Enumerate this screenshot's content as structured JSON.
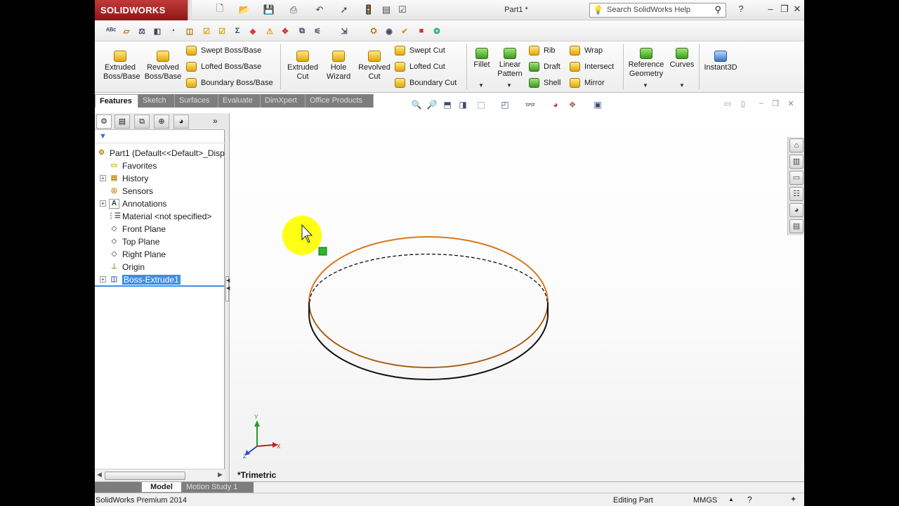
{
  "app": {
    "brand": "SOLIDWORKS",
    "document_title": "Part1 *",
    "search_placeholder": "Search SolidWorks Help"
  },
  "command_manager": {
    "extruded_boss": "Extruded\nBoss/Base",
    "revolved_boss": "Revolved\nBoss/Base",
    "swept_boss": "Swept Boss/Base",
    "lofted_boss": "Lofted Boss/Base",
    "boundary_boss": "Boundary Boss/Base",
    "extruded_cut": "Extruded\nCut",
    "hole_wizard": "Hole\nWizard",
    "revolved_cut": "Revolved\nCut",
    "swept_cut": "Swept Cut",
    "lofted_cut": "Lofted Cut",
    "boundary_cut": "Boundary Cut",
    "fillet": "Fillet",
    "linear_pattern": "Linear\nPattern",
    "rib": "Rib",
    "draft": "Draft",
    "shell": "Shell",
    "wrap": "Wrap",
    "intersect": "Intersect",
    "mirror": "Mirror",
    "reference_geometry": "Reference\nGeometry",
    "curves": "Curves",
    "instant3d": "Instant3D"
  },
  "tabs": [
    "Features",
    "Sketch",
    "Surfaces",
    "Evaluate",
    "DimXpert",
    "Office Products"
  ],
  "feature_tree": {
    "root": "Part1  (Default<<Default>_Disp",
    "items": [
      {
        "label": "Favorites",
        "icon": "folder-icon"
      },
      {
        "label": "History",
        "icon": "history-icon"
      },
      {
        "label": "Sensors",
        "icon": "sensor-icon"
      },
      {
        "label": "Annotations",
        "icon": "annotation-icon"
      },
      {
        "label": "Material <not specified>",
        "icon": "material-icon"
      },
      {
        "label": "Front Plane",
        "icon": "plane-icon"
      },
      {
        "label": "Top Plane",
        "icon": "plane-icon"
      },
      {
        "label": "Right Plane",
        "icon": "plane-icon"
      },
      {
        "label": "Origin",
        "icon": "origin-icon"
      },
      {
        "label": "Boss-Extrude1",
        "icon": "extrude-icon"
      }
    ]
  },
  "graphics": {
    "view_orientation": "*Trimetric",
    "axis_x": "X",
    "axis_y": "Y",
    "axis_z": "Z",
    "edge_highlight_color": "#d9781e"
  },
  "bottom_tabs": [
    "Model",
    "Motion Study 1"
  ],
  "status": {
    "product": "SolidWorks Premium 2014",
    "mode": "Editing Part",
    "units": "MMGS"
  }
}
